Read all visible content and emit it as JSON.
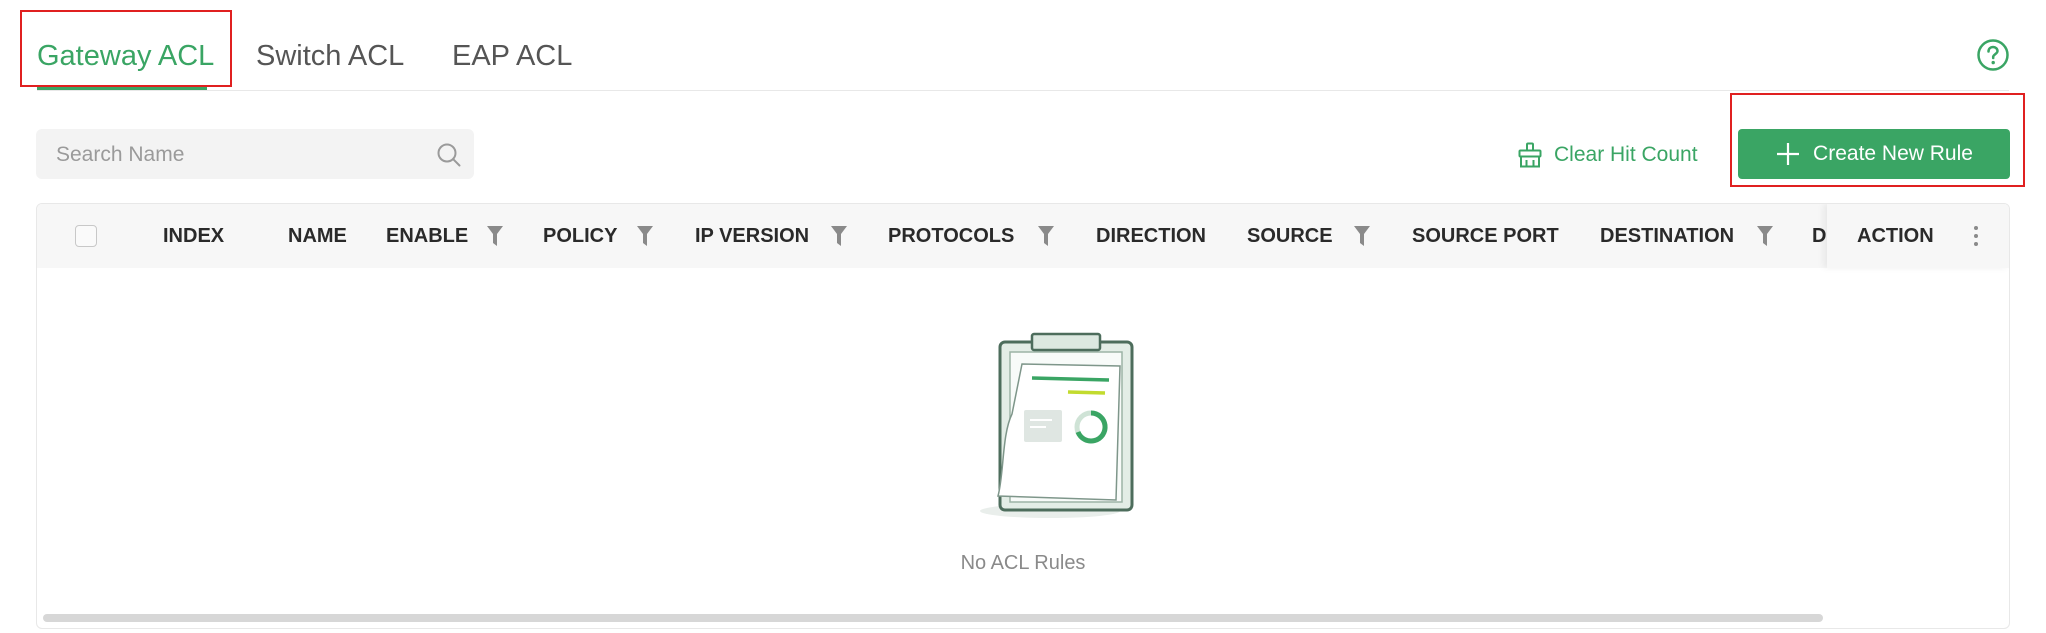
{
  "tabs": [
    {
      "label": "Gateway ACL",
      "active": true
    },
    {
      "label": "Switch ACL",
      "active": false
    },
    {
      "label": "EAP ACL",
      "active": false
    }
  ],
  "help": {
    "icon": "help-circle-icon"
  },
  "search": {
    "placeholder": "Search Name",
    "value": "",
    "icon": "search-icon"
  },
  "actions": {
    "clear_hit_count": {
      "label": "Clear Hit Count",
      "icon": "broom-icon"
    },
    "create_new_rule": {
      "label": "Create New Rule",
      "icon": "plus-icon"
    }
  },
  "table": {
    "columns": [
      {
        "label": "INDEX",
        "filter": false
      },
      {
        "label": "NAME",
        "filter": false
      },
      {
        "label": "ENABLE",
        "filter": true
      },
      {
        "label": "POLICY",
        "filter": true
      },
      {
        "label": "IP VERSION",
        "filter": true
      },
      {
        "label": "PROTOCOLS",
        "filter": true
      },
      {
        "label": "DIRECTION",
        "filter": false
      },
      {
        "label": "SOURCE",
        "filter": true
      },
      {
        "label": "SOURCE PORT",
        "filter": false
      },
      {
        "label": "DESTINATION",
        "filter": true
      },
      {
        "label": "D",
        "filter": false
      },
      {
        "label": "ACTION",
        "filter": false
      }
    ],
    "rows": [],
    "empty_message": "No ACL Rules"
  },
  "colors": {
    "accent": "#3aa564",
    "highlight": "#e02020"
  }
}
